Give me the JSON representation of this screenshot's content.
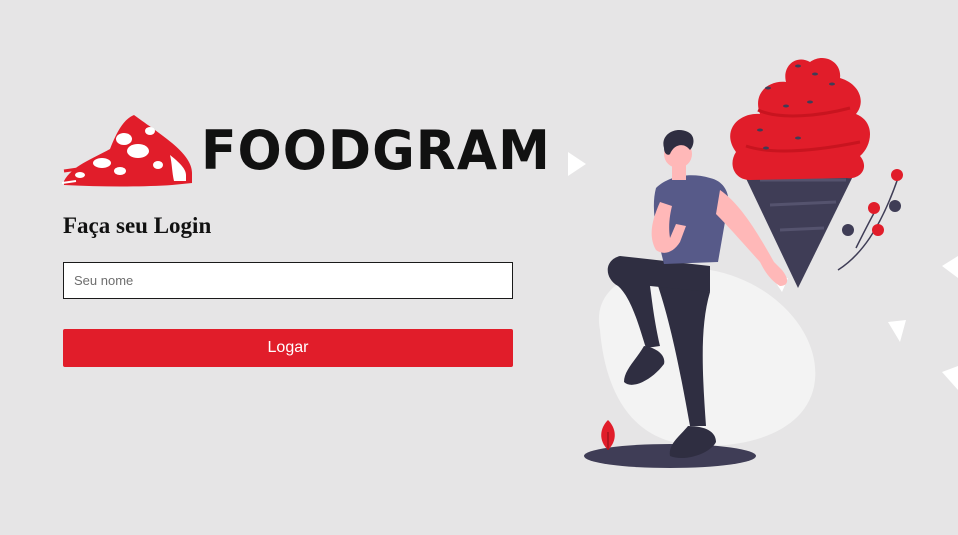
{
  "brand": {
    "name": "FOODGRAM",
    "logo_icon": "pizza-slice-icon",
    "accent_color": "#e11d2a"
  },
  "login": {
    "title": "Faça seu Login",
    "name_placeholder": "Seu nome",
    "name_value": "",
    "submit_label": "Logar"
  },
  "illustration": {
    "icon": "person-with-ice-cream-illustration"
  }
}
